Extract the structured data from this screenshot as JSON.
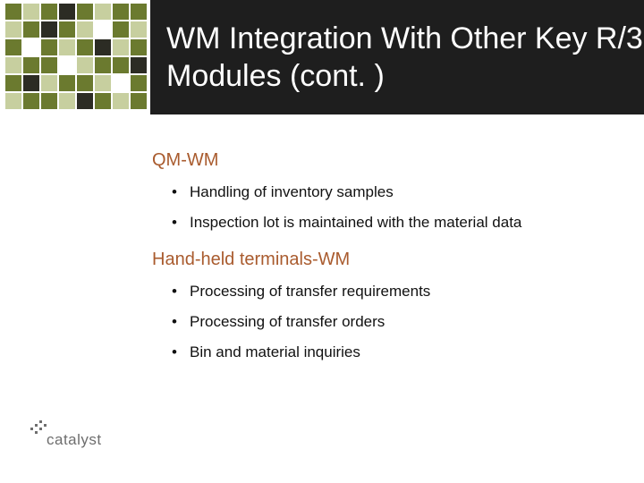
{
  "title": "WM Integration With Other Key R/3 Modules (cont. )",
  "sections": [
    {
      "heading": "QM-WM",
      "bullets": [
        "Handling of inventory samples",
        "Inspection lot is maintained with the material data"
      ]
    },
    {
      "heading": "Hand-held terminals-WM",
      "bullets": [
        "Processing of transfer requirements",
        "Processing of transfer orders",
        "Bin and material inquiries"
      ]
    }
  ],
  "logo_text": "catalyst"
}
